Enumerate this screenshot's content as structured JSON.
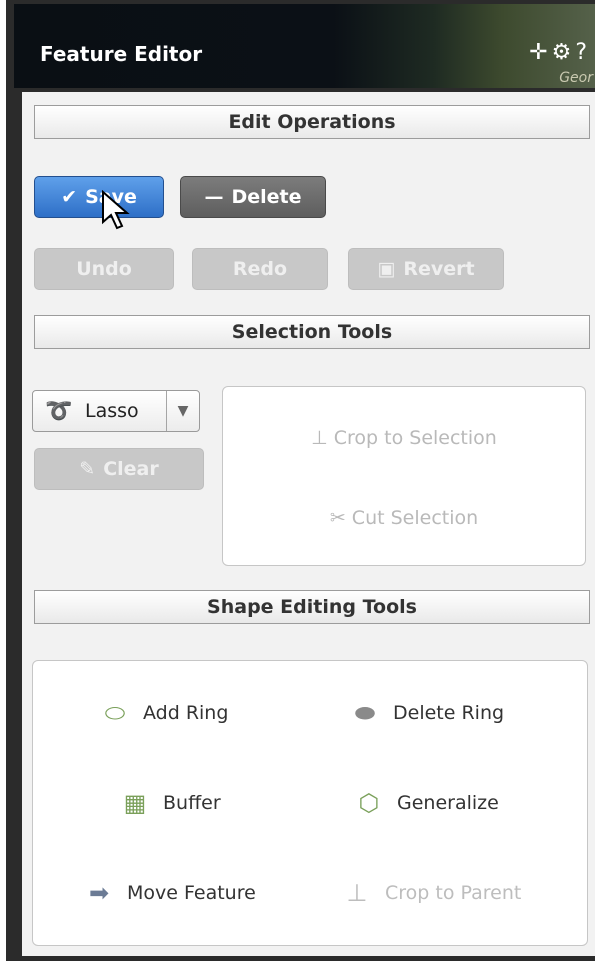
{
  "window": {
    "title": "Feature Editor",
    "map_label": "Geor",
    "icons": [
      "move-icon",
      "gear-icon",
      "help-icon"
    ]
  },
  "edit_operations": {
    "header": "Edit Operations",
    "save_label": "Save",
    "delete_label": "Delete",
    "undo_label": "Undo",
    "redo_label": "Redo",
    "revert_label": "Revert"
  },
  "selection_tools": {
    "header": "Selection Tools",
    "lasso_label": "Lasso",
    "clear_label": "Clear",
    "crop_label": "Crop to Selection",
    "cut_label": "Cut Selection"
  },
  "shape_editing_tools": {
    "header": "Shape Editing Tools",
    "add_ring": "Add Ring",
    "delete_ring": "Delete Ring",
    "buffer": "Buffer",
    "generalize": "Generalize",
    "move_feature": "Move Feature",
    "crop_to_parent": "Crop to Parent"
  },
  "colors": {
    "accent_blue": "#2e6fc7",
    "dark_button": "#5e5e5e",
    "disabled": "#c8c8c8"
  }
}
